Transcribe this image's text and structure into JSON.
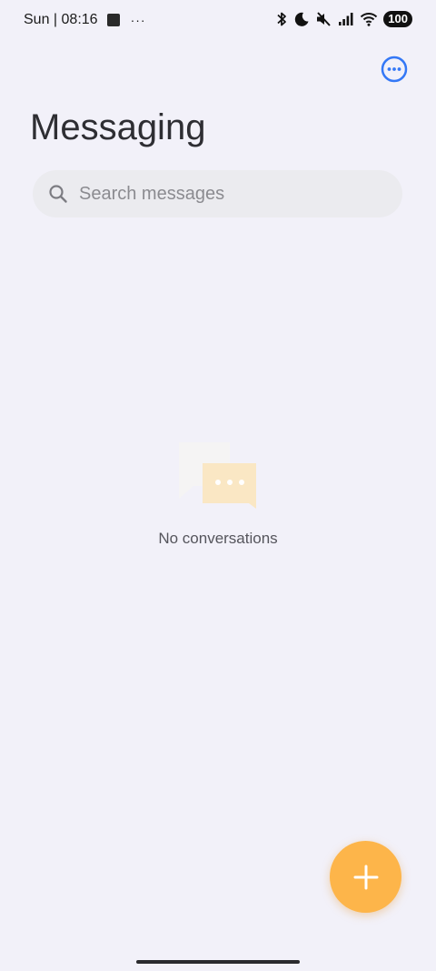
{
  "status_bar": {
    "time": "Sun | 08:16",
    "overflow": "···",
    "battery": "100",
    "icons": [
      "bluetooth-icon",
      "moon-icon",
      "mute-icon",
      "signal-icon",
      "wifi-icon",
      "battery-icon"
    ]
  },
  "header": {
    "title": "Messaging",
    "more_icon": "more-options-icon"
  },
  "search": {
    "placeholder": "Search messages",
    "value": "",
    "icon": "search-icon"
  },
  "empty_state": {
    "text": "No conversations",
    "icon": "chat-bubbles-icon"
  },
  "fab": {
    "icon": "plus-icon"
  },
  "colors": {
    "background": "#f2f1f9",
    "accent_blue": "#3478f6",
    "fab_orange": "#fdb54a",
    "search_bg": "#ebebef"
  }
}
